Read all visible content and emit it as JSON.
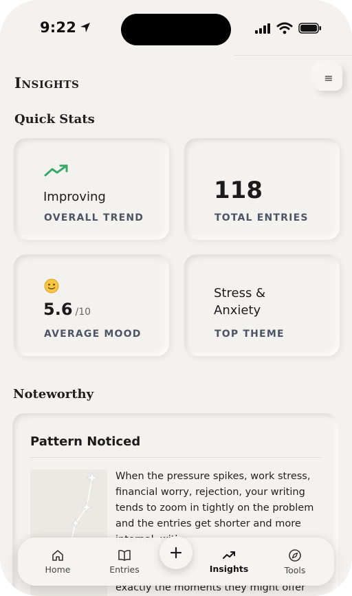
{
  "status_bar": {
    "time": "9:22"
  },
  "header": {
    "title": "Insights",
    "menu_icon": "hamburger-menu-icon"
  },
  "quick_stats": {
    "title": "Quick Stats",
    "cards": [
      {
        "icon": "trending-up-icon",
        "icon_color": "#3aa86b",
        "value": "Improving",
        "label": "OVERALL TREND"
      },
      {
        "value": "118",
        "label": "TOTAL ENTRIES"
      },
      {
        "icon": "smiley-emoji",
        "value": "5.6",
        "unit": "/10",
        "label": "AVERAGE MOOD"
      },
      {
        "value_line1": "Stress &",
        "value_line2": "Anxiety",
        "label": "TOP THEME"
      }
    ]
  },
  "noteworthy": {
    "title": "Noteworthy",
    "card": {
      "title": "Pattern Noticed",
      "body": "When the pressure spikes, work stress, financial worry, rejection, your writing tends to zoom in tightly on the problem and the entries get shorter and more internal, with",
      "tail": "exactly the moments they might offer some"
    }
  },
  "bottom_nav": {
    "items": [
      {
        "label": "Home",
        "icon": "home-icon"
      },
      {
        "label": "Entries",
        "icon": "book-icon"
      },
      {
        "label": "Insights",
        "icon": "trending-up-icon",
        "active": true
      },
      {
        "label": "Tools",
        "icon": "compass-icon"
      }
    ],
    "fab_icon": "plus-icon"
  }
}
